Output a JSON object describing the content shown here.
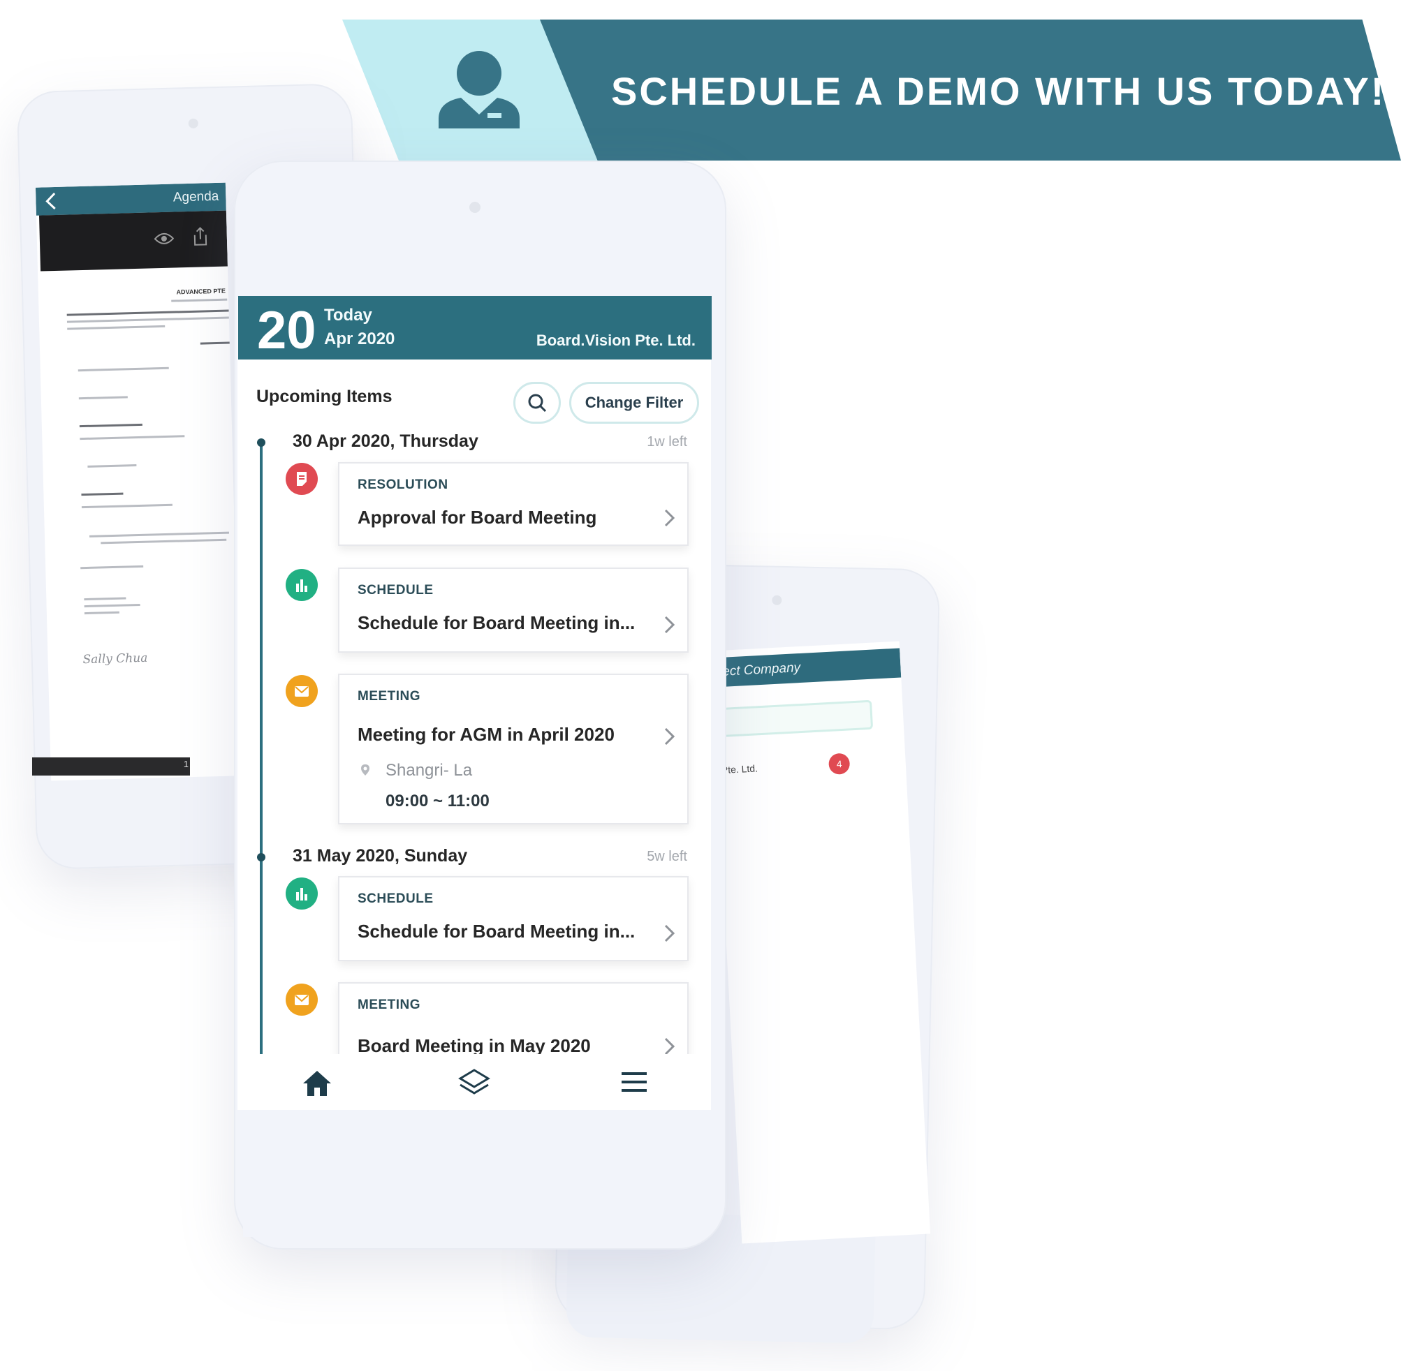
{
  "banner": {
    "text": "SCHEDULE A DEMO WITH US TODAY!",
    "icon": "person-icon"
  },
  "colors": {
    "banner_dark": "#377487",
    "banner_light": "#c0ecf2",
    "header_teal": "#2c6f7f",
    "resolution": "#e04a52",
    "schedule": "#21b083",
    "meeting": "#f0a21e"
  },
  "left_phone": {
    "header_title": "Agenda",
    "doc_title": "ADVANCED PTE",
    "signature": "Sally Chua",
    "page_number": "1"
  },
  "right_phone": {
    "header_title": "elect Company",
    "company": "Pte. Ltd.",
    "badge": "4"
  },
  "main": {
    "date_day": "20",
    "date_today": "Today",
    "date_month": "Apr 2020",
    "company_name": "Board.Vision Pte. Ltd.",
    "upcoming_title": "Upcoming Items",
    "filter_label": "Change Filter",
    "groups": [
      {
        "date": "30 Apr 2020, Thursday",
        "left": "1w left",
        "items": [
          {
            "type": "RESOLUTION",
            "title": "Approval for Board Meeting",
            "icon": "document-icon"
          },
          {
            "type": "SCHEDULE",
            "title": "Schedule for Board Meeting in...",
            "icon": "bar-chart-icon"
          },
          {
            "type": "MEETING",
            "title": "Meeting for AGM in April 2020",
            "location": "Shangri- La",
            "time": "09:00 ~ 11:00",
            "icon": "envelope-icon"
          }
        ]
      },
      {
        "date": "31 May 2020, Sunday",
        "left": "5w left",
        "items": [
          {
            "type": "SCHEDULE",
            "title": "Schedule for Board Meeting in...",
            "icon": "bar-chart-icon"
          },
          {
            "type": "MEETING",
            "title": "Board Meeting in May 2020",
            "icon": "envelope-icon"
          }
        ]
      }
    ],
    "nav": [
      "home-icon",
      "layers-icon",
      "menu-icon"
    ]
  }
}
